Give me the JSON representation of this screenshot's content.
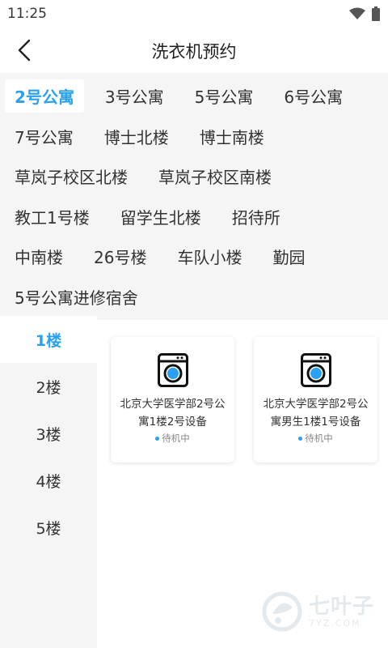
{
  "status_bar": {
    "time": "11:25"
  },
  "header": {
    "title": "洗衣机预约"
  },
  "buildings": [
    [
      "2号公寓",
      "3号公寓",
      "5号公寓",
      "6号公寓"
    ],
    [
      "7号公寓",
      "博士北楼",
      "博士南楼"
    ],
    [
      "草岚子校区北楼",
      "草岚子校区南楼"
    ],
    [
      "教工1号楼",
      "留学生北楼",
      "招待所"
    ],
    [
      "中南楼",
      "26号楼",
      "车队小楼",
      "勤园"
    ],
    [
      "5号公寓进修宿舍"
    ]
  ],
  "selected_building": "2号公寓",
  "floors": [
    "1楼",
    "2楼",
    "3楼",
    "4楼",
    "5楼"
  ],
  "selected_floor": "1楼",
  "devices": [
    {
      "name": "北京大学医学部2号公寓1楼2号设备",
      "status": "待机中"
    },
    {
      "name": "北京大学医学部2号公寓男生1楼1号设备",
      "status": "待机中"
    }
  ],
  "watermark": {
    "text": "七叶子",
    "url": "7YZ.COM"
  },
  "colors": {
    "accent": "#2aa0f0",
    "panel_bg": "#f5f5f5"
  }
}
